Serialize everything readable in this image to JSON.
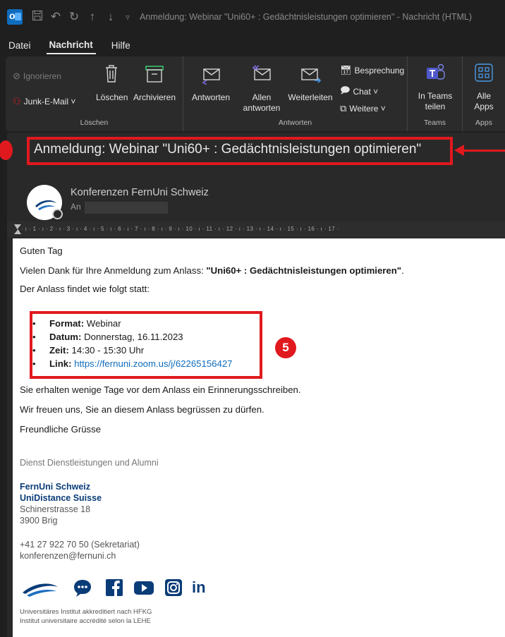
{
  "window": {
    "title": "Anmeldung: Webinar \"Uni60+ : Gedächtnisleistungen optimieren\"  -  Nachricht (HTML)"
  },
  "menu": {
    "items": [
      "Datei",
      "Nachricht",
      "Hilfe"
    ]
  },
  "ribbon": {
    "group_loeschen": {
      "label": "Löschen",
      "ignorieren": "Ignorieren",
      "junk": "Junk-E-Mail ˅",
      "loeschen": "Löschen",
      "archivieren": "Archivieren"
    },
    "group_antworten": {
      "label": "Antworten",
      "antworten": "Antworten",
      "allen_antworten_1": "Allen",
      "allen_antworten_2": "antworten",
      "weiterleiten": "Weiterleiten",
      "besprechung": "Besprechung",
      "chat": "Chat ˅",
      "weitere": "Weitere ˅"
    },
    "group_teams": {
      "label": "Teams",
      "in_teams_1": "In Teams",
      "in_teams_2": "teilen"
    },
    "group_apps": {
      "label": "Apps",
      "alle_1": "Alle",
      "alle_2": "Apps"
    }
  },
  "header": {
    "subject": "Anmeldung: Webinar \"Uni60+ : Gedächtnisleistungen optimieren\"",
    "sender": "Konferenzen FernUni Schweiz",
    "to_label": "An"
  },
  "ruler": {
    "text": "· ı · 1 · ı · 2 · ı · 3 · ı · 4 · ı · 5 · ı · 6 · ı · 7 · ı · 8 · ı · 9 · ı · 10 · ı · 11 · ı · 12 · ı · 13 · ı · 14 · ı · 15 · ı · 16 · ı · 17 ·"
  },
  "body": {
    "greeting": "Guten Tag",
    "thanks_prefix": "Vielen Dank für Ihre Anmeldung zum Anlass: ",
    "thanks_bold": "\"Uni60+ : Gedächtnisleistungen optimieren\"",
    "thanks_suffix": ".",
    "intro": "Der Anlass findet wie folgt statt:",
    "details": [
      {
        "label": "Format:",
        "value": " Webinar"
      },
      {
        "label": "Datum:",
        "value": " Donnerstag, 16.11.2023"
      },
      {
        "label": "Zeit:",
        "value": " 14:30 - 15:30 Uhr"
      },
      {
        "label": "Link:",
        "value": " https://fernuni.zoom.us/j/62265156427"
      }
    ],
    "annotation_number": "5",
    "reminder": "Sie erhalten wenige Tage vor dem Anlass ein Erinnerungsschreiben.",
    "welcome": "Wir freuen uns, Sie an diesem Anlass begrüssen zu dürfen.",
    "closing": "Freundliche Grüsse"
  },
  "signature": {
    "department": "Dienst Dienstleistungen und Alumni",
    "org1": "FernUni Schweiz",
    "org2": "UniDistance Suisse",
    "street": "Schinerstrasse 18",
    "city": "3900 Brig",
    "phone": "+41 27 922 70 50 (Sekretariat)",
    "email": "konferenzen@fernuni.ch",
    "social_linkedin": "in",
    "accred1": "Universitäres Institut akkreditiert nach HFKG",
    "accred2": "Institut universitaire accrédité selon la LEHE"
  },
  "colors": {
    "accent_red": "#e0191e",
    "link_blue": "#0f6cbd",
    "org_blue": "#0a3c78"
  }
}
